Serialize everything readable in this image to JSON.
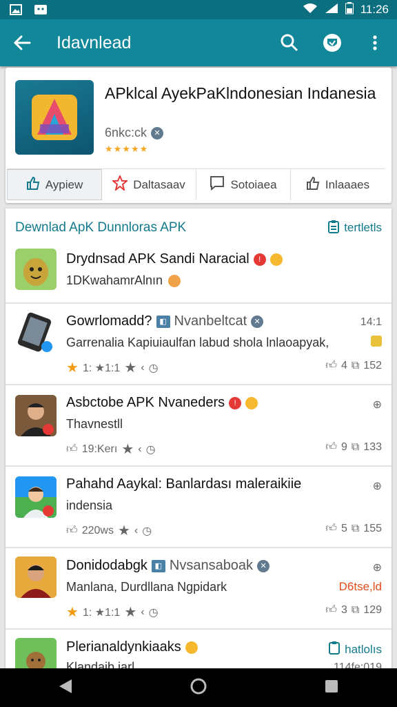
{
  "status": {
    "time": "11:26"
  },
  "appbar": {
    "title": "Idavnlead"
  },
  "hero": {
    "title": "APklcal AyekPaKlndonesian Indanesia",
    "developer": "6nkc:ck",
    "rating_stars": "★★★★★"
  },
  "tabs": [
    {
      "label": "Aypiew"
    },
    {
      "label": "Daltasaav"
    },
    {
      "label": "Sotoiaea"
    },
    {
      "label": "Inlaaaes"
    }
  ],
  "list": {
    "header": "Dewnlad ApK Dunnloras APK",
    "header_link": "tertletls",
    "items": [
      {
        "title": "Drydnsad APK Sandi Naracial",
        "sub": "1DKwahamrAlnın"
      },
      {
        "title": "Gowrlomadd?",
        "tag": "Nvanbeltcat",
        "time": "14:1",
        "sub": "Garrenalia Kapiuiaulfan labud shola lnlaoapyak,",
        "meta": "1: ★1:1",
        "likes": "4",
        "comments": "152"
      },
      {
        "title": "Asbctobe APK Nvaneders",
        "sub": "Thavnestll",
        "meta": "19:Kerı",
        "likes": "9",
        "comments": "133"
      },
      {
        "title": "Pahahd Aaykal: Banlardası maleraikiie",
        "sub": "indensia",
        "meta": "220ws",
        "likes": "5",
        "comments": "155"
      },
      {
        "title": "Donidodabgk",
        "tag": "Nvsansaboak",
        "sub": "Manlana, Durdllana Ngpidark",
        "meta": "1: ★1:1",
        "price": "D6tse,ld",
        "likes": "3",
        "comments": "129"
      },
      {
        "title": "Plerianaldynkiaaks",
        "sub": "Klandaib iarl",
        "link": "hatlolıs",
        "time": "114fe:019"
      }
    ]
  },
  "colors": {
    "accent": "#12879a",
    "status_bar": "#0b6f80",
    "star": "#f39c12"
  }
}
